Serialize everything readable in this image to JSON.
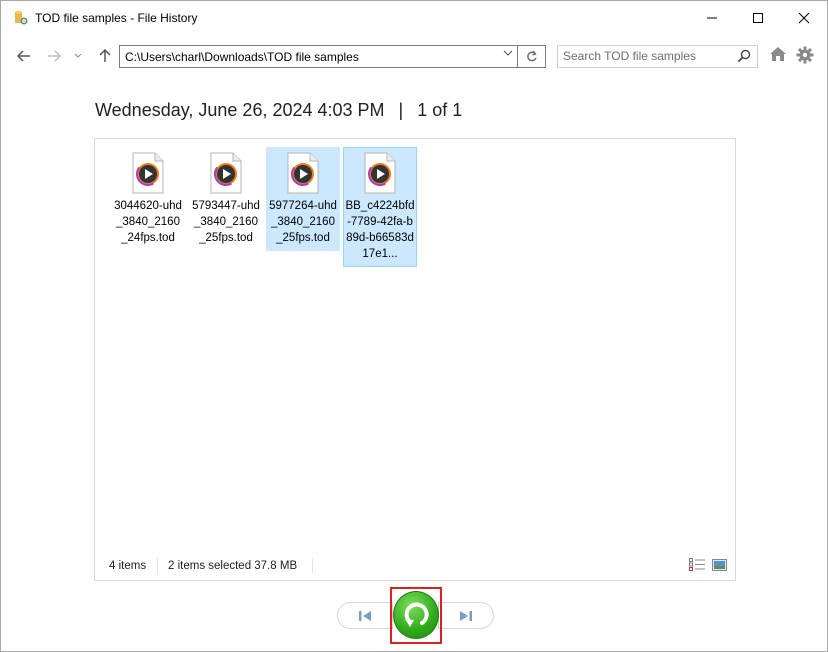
{
  "window": {
    "title": "TOD file samples - File History",
    "controls": {
      "minimize": "minimize",
      "maximize": "maximize",
      "close": "close"
    }
  },
  "nav": {
    "address": "C:\\Users\\charl\\Downloads\\TOD file samples",
    "search_placeholder": "Search TOD file samples"
  },
  "header": {
    "date": "Wednesday, June 26, 2024 4:03 PM",
    "separator": "|",
    "page": "1 of 1"
  },
  "files": [
    {
      "name": "3044620-uhd_3840_2160_24fps.tod",
      "display": "3044620-uhd_3840_2160_24fps.tod",
      "selected": false,
      "focused": false
    },
    {
      "name": "5793447-uhd_3840_2160_25fps.tod",
      "display": "5793447-uhd_3840_2160_25fps.tod",
      "selected": false,
      "focused": false
    },
    {
      "name": "5977264-uhd_3840_2160_25fps.tod",
      "display": "5977264-uhd_3840_2160_25fps.tod",
      "selected": true,
      "focused": false
    },
    {
      "name": "BB_c4224bfd-7789-42fa-b89d-b66583d17e1...",
      "display": "BB_c4224bfd-7789-42fa-b89d-b66583d17e1...",
      "selected": true,
      "focused": true
    }
  ],
  "status": {
    "item_count": "4 items",
    "selection": "2 items selected  37.8 MB"
  },
  "colors": {
    "selection_bg": "#cce8ff",
    "focus_border": "#99d1ff",
    "restore_green": "#2ea81a",
    "highlight_red": "#e02020"
  },
  "icons": {
    "back": "arrow-left-icon",
    "forward": "arrow-right-icon",
    "recent": "chevron-down-icon",
    "up": "arrow-up-icon",
    "refresh": "refresh-icon",
    "search": "search-icon",
    "home": "home-icon",
    "settings": "gear-icon",
    "previous": "previous-version-icon",
    "restore": "restore-icon",
    "next": "next-version-icon"
  }
}
